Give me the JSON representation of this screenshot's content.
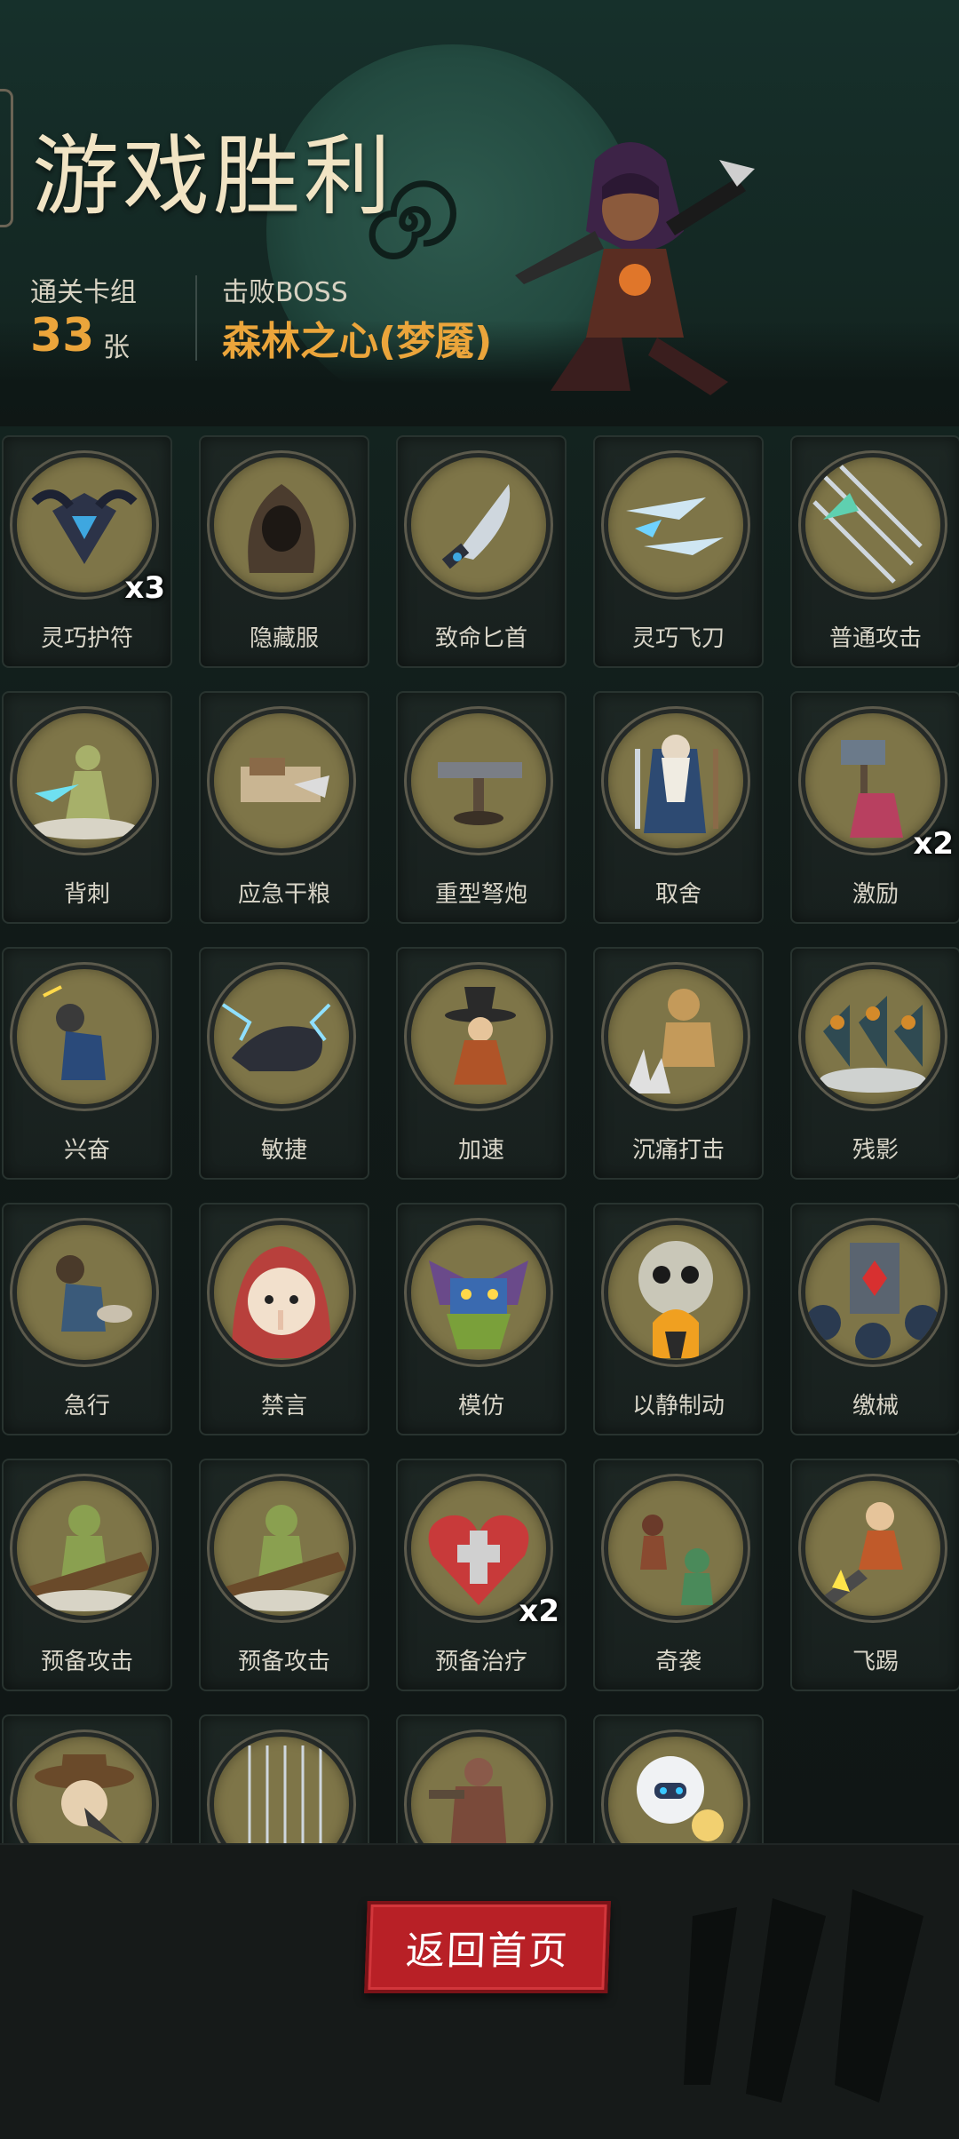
{
  "header": {
    "title": "游戏胜利",
    "deck_label": "通关卡组",
    "deck_count": "33",
    "deck_unit": "张",
    "boss_label": "击败BOSS",
    "boss_name": "森林之心(梦魇)"
  },
  "cards": [
    {
      "name": "灵巧护符",
      "count": "x3",
      "icon": "amulet-icon",
      "bg": "#7e7548"
    },
    {
      "name": "隐藏服",
      "count": "",
      "icon": "hood-icon",
      "bg": "#7e7548"
    },
    {
      "name": "致命匕首",
      "count": "",
      "icon": "dagger-icon",
      "bg": "#7e7548"
    },
    {
      "name": "灵巧飞刀",
      "count": "",
      "icon": "throwing-knife-icon",
      "bg": "#7e7548"
    },
    {
      "name": "普通攻击",
      "count": "",
      "icon": "arrows-icon",
      "bg": "#7e7548"
    },
    {
      "name": "背刺",
      "count": "",
      "icon": "backstab-icon",
      "bg": "#7e7548"
    },
    {
      "name": "应急干粮",
      "count": "",
      "icon": "rations-icon",
      "bg": "#7e7548"
    },
    {
      "name": "重型弩炮",
      "count": "",
      "icon": "ballista-icon",
      "bg": "#7e7548"
    },
    {
      "name": "取舍",
      "count": "",
      "icon": "sage-icon",
      "bg": "#7e7548"
    },
    {
      "name": "激励",
      "count": "x2",
      "icon": "hammer-icon",
      "bg": "#7e7548"
    },
    {
      "name": "兴奋",
      "count": "",
      "icon": "excited-dwarf-icon",
      "bg": "#7e7548"
    },
    {
      "name": "敏捷",
      "count": "",
      "icon": "panther-icon",
      "bg": "#7e7548"
    },
    {
      "name": "加速",
      "count": "",
      "icon": "witch-icon",
      "bg": "#7e7548"
    },
    {
      "name": "沉痛打击",
      "count": "",
      "icon": "brute-icon",
      "bg": "#7e7548"
    },
    {
      "name": "残影",
      "count": "",
      "icon": "afterimage-icon",
      "bg": "#7e7548"
    },
    {
      "name": "急行",
      "count": "",
      "icon": "running-dwarf-icon",
      "bg": "#7e7548"
    },
    {
      "name": "禁言",
      "count": "",
      "icon": "silence-girl-icon",
      "bg": "#7e7548"
    },
    {
      "name": "模仿",
      "count": "",
      "icon": "goblin-mask-icon",
      "bg": "#7e7548"
    },
    {
      "name": "以静制动",
      "count": "",
      "icon": "skull-flame-icon",
      "bg": "#7e7548"
    },
    {
      "name": "缴械",
      "count": "",
      "icon": "disarm-card-icon",
      "bg": "#7e7548"
    },
    {
      "name": "预备攻击",
      "count": "",
      "icon": "goblin-log-icon",
      "bg": "#7e7548"
    },
    {
      "name": "预备攻击",
      "count": "",
      "icon": "goblin-log-icon",
      "bg": "#7e7548"
    },
    {
      "name": "预备治疗",
      "count": "x2",
      "icon": "heart-cross-icon",
      "bg": "#7e7548"
    },
    {
      "name": "奇袭",
      "count": "",
      "icon": "ambush-icon",
      "bg": "#7e7548"
    },
    {
      "name": "飞踢",
      "count": "",
      "icon": "flying-kick-icon",
      "bg": "#7e7548"
    },
    {
      "name": "",
      "count": "",
      "icon": "plague-doctor-icon",
      "bg": "#7e7548"
    },
    {
      "name": "",
      "count": "",
      "icon": "arrow-rain-icon",
      "bg": "#7e7548"
    },
    {
      "name": "",
      "count": "",
      "icon": "warrior-icon",
      "bg": "#7e7548"
    },
    {
      "name": "",
      "count": "",
      "icon": "robot-icon",
      "bg": "#7e7548"
    }
  ],
  "footer": {
    "home_button": "返回首页"
  },
  "colors": {
    "accent": "#eba53b",
    "button": "#b82026",
    "medallion": "#7e7548"
  }
}
